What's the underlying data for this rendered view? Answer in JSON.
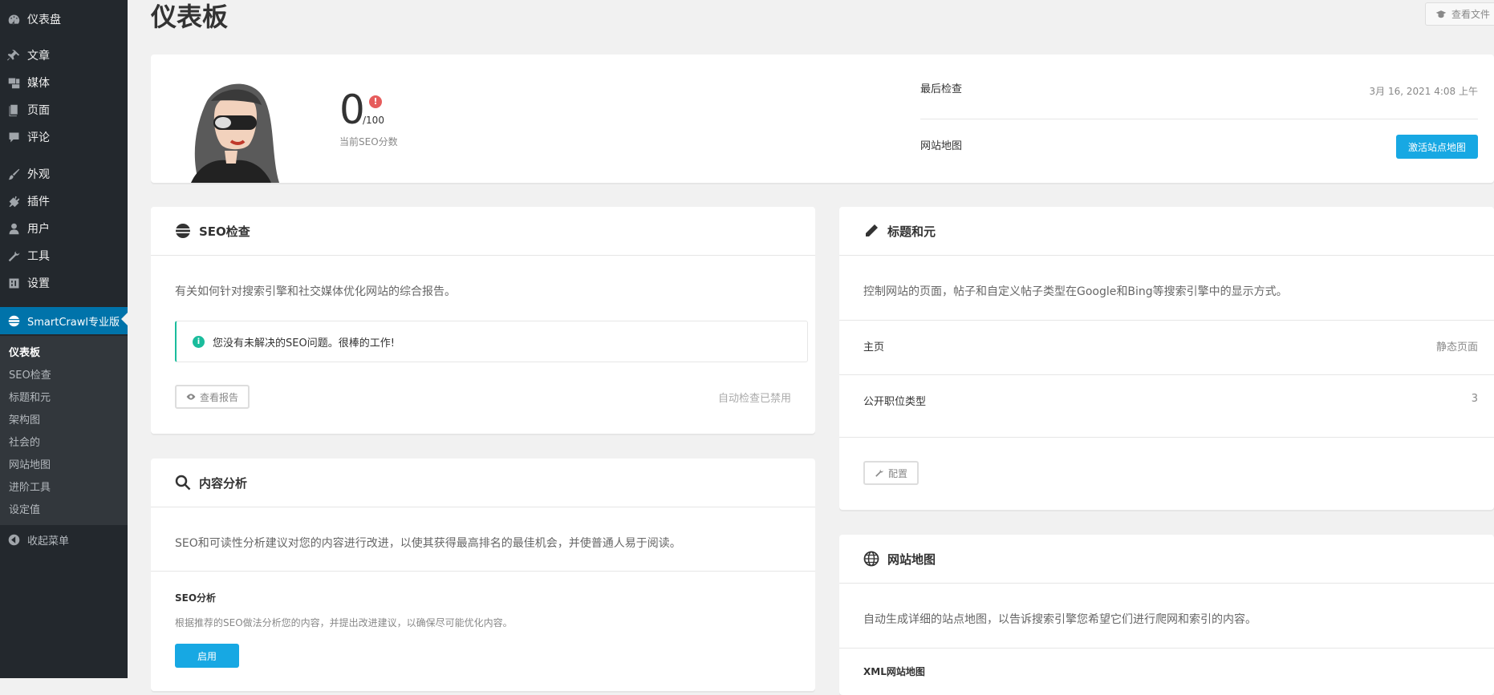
{
  "sidebar": {
    "items": [
      {
        "label": "仪表盘",
        "icon": "dashboard-icon"
      },
      {
        "label": "文章",
        "icon": "pin-icon"
      },
      {
        "label": "媒体",
        "icon": "media-icon"
      },
      {
        "label": "页面",
        "icon": "page-icon"
      },
      {
        "label": "评论",
        "icon": "comment-icon"
      },
      {
        "label": "外观",
        "icon": "brush-icon"
      },
      {
        "label": "插件",
        "icon": "plugin-icon"
      },
      {
        "label": "用户",
        "icon": "user-icon"
      },
      {
        "label": "工具",
        "icon": "wrench-icon"
      },
      {
        "label": "设置",
        "icon": "settings-icon"
      }
    ],
    "active": {
      "label": "SmartCrawl专业版",
      "icon": "smartcrawl-icon"
    },
    "submenu": [
      "仪表板",
      "SEO检查",
      "标题和元",
      "架构图",
      "社会的",
      "网站地图",
      "进阶工具",
      "设定值"
    ],
    "collapse_label": "收起菜单"
  },
  "header": {
    "title": "仪表板",
    "docs_label": "查看文件"
  },
  "summary": {
    "score": "0",
    "score_max": "/100",
    "score_label": "当前SEO分数",
    "last_check_label": "最后检查",
    "last_check_value": "3月 16, 2021 4:08 上午",
    "sitemap_label": "网站地图",
    "sitemap_button": "激活站点地图",
    "alert_color": "#e65c5c"
  },
  "seo_check": {
    "title": "SEO检查",
    "description": "有关如何针对搜索引擎和社交媒体优化网站的综合报告。",
    "notice": "您没有未解决的SEO问题。很棒的工作!",
    "view_report": "查看报告",
    "auto_status": "自动检查已禁用",
    "notice_color": "#1abc9c"
  },
  "content_analysis": {
    "title": "内容分析",
    "description": "SEO和可读性分析建议对您的内容进行改进，以使其获得最高排名的最佳机会，并使普通人易于阅读。",
    "seo_title": "SEO分析",
    "seo_desc": "根据推荐的SEO做法分析您的内容，并提出改进建议，以确保尽可能优化内容。",
    "enable_button": "启用"
  },
  "titles_meta": {
    "title": "标题和元",
    "description": "控制网站的页面，帖子和自定义帖子类型在Google和Bing等搜索引擎中的显示方式。",
    "rows": [
      {
        "label": "主页",
        "value": "静态页面"
      },
      {
        "label": "公开职位类型",
        "value": "3"
      }
    ],
    "configure_button": "配置"
  },
  "sitemap_box": {
    "title": "网站地图",
    "description": "自动生成详细的站点地图，以告诉搜索引擎您希望它们进行爬网和索引的内容。",
    "xml_label": "XML网站地图"
  },
  "colors": {
    "sidebar_bg": "#23282d",
    "active_bg": "#0073aa",
    "accent": "#17a8e3"
  }
}
